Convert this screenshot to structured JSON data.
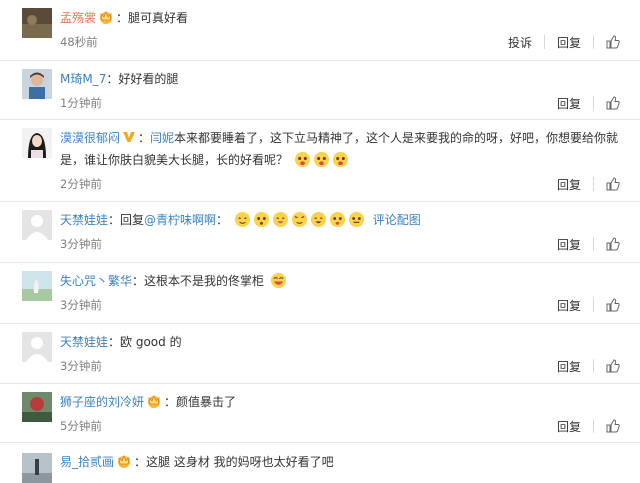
{
  "actions": {
    "report": "投诉",
    "reply": "回复"
  },
  "comments": [
    {
      "user": "孟殇裳",
      "text": "：腿可真好看",
      "time": "48秒前"
    },
    {
      "user": "M琦M_7",
      "text": "：好好看的腿",
      "time": "1分钟前"
    },
    {
      "user": "漠漠很郁闷",
      "mention": "闫妮",
      "text_line1": "本来都要睡着了，这下立马精神了，这个人是来要我的命的呀，好吧，你想要给你就",
      "text_line2": "是，谁让你肤白貌美大长腿，长的好看呢？",
      "time": "2分钟前"
    },
    {
      "user": "天禁娃娃",
      "reply_prefix": "：回复",
      "reply_target": "@青柠味啊啊",
      "reply_suffix": "：",
      "pic_link": "评论配图",
      "time": "3分钟前"
    },
    {
      "user": "失心咒丶繁华",
      "text": "：这根本不是我的佟掌柜",
      "time": "3分钟前"
    },
    {
      "user": "天禁娃娃",
      "text": "：欧 good 的",
      "time": "3分钟前"
    },
    {
      "user": "狮子座的刘冷妍",
      "text": "：颜值暴击了",
      "time": "5分钟前"
    },
    {
      "user": "易_拾贰画",
      "text": "：这腿 这身材 我的妈呀也太好看了吧",
      "time": ""
    }
  ],
  "icons": {
    "like": "thumbs-up-icon",
    "vip": "crown-badge-icon",
    "verified": "v-verified-icon",
    "emoji": "emoji-icon"
  },
  "colors": {
    "username": "#eb7350",
    "link": "#3b82c4",
    "muted": "#808080"
  }
}
